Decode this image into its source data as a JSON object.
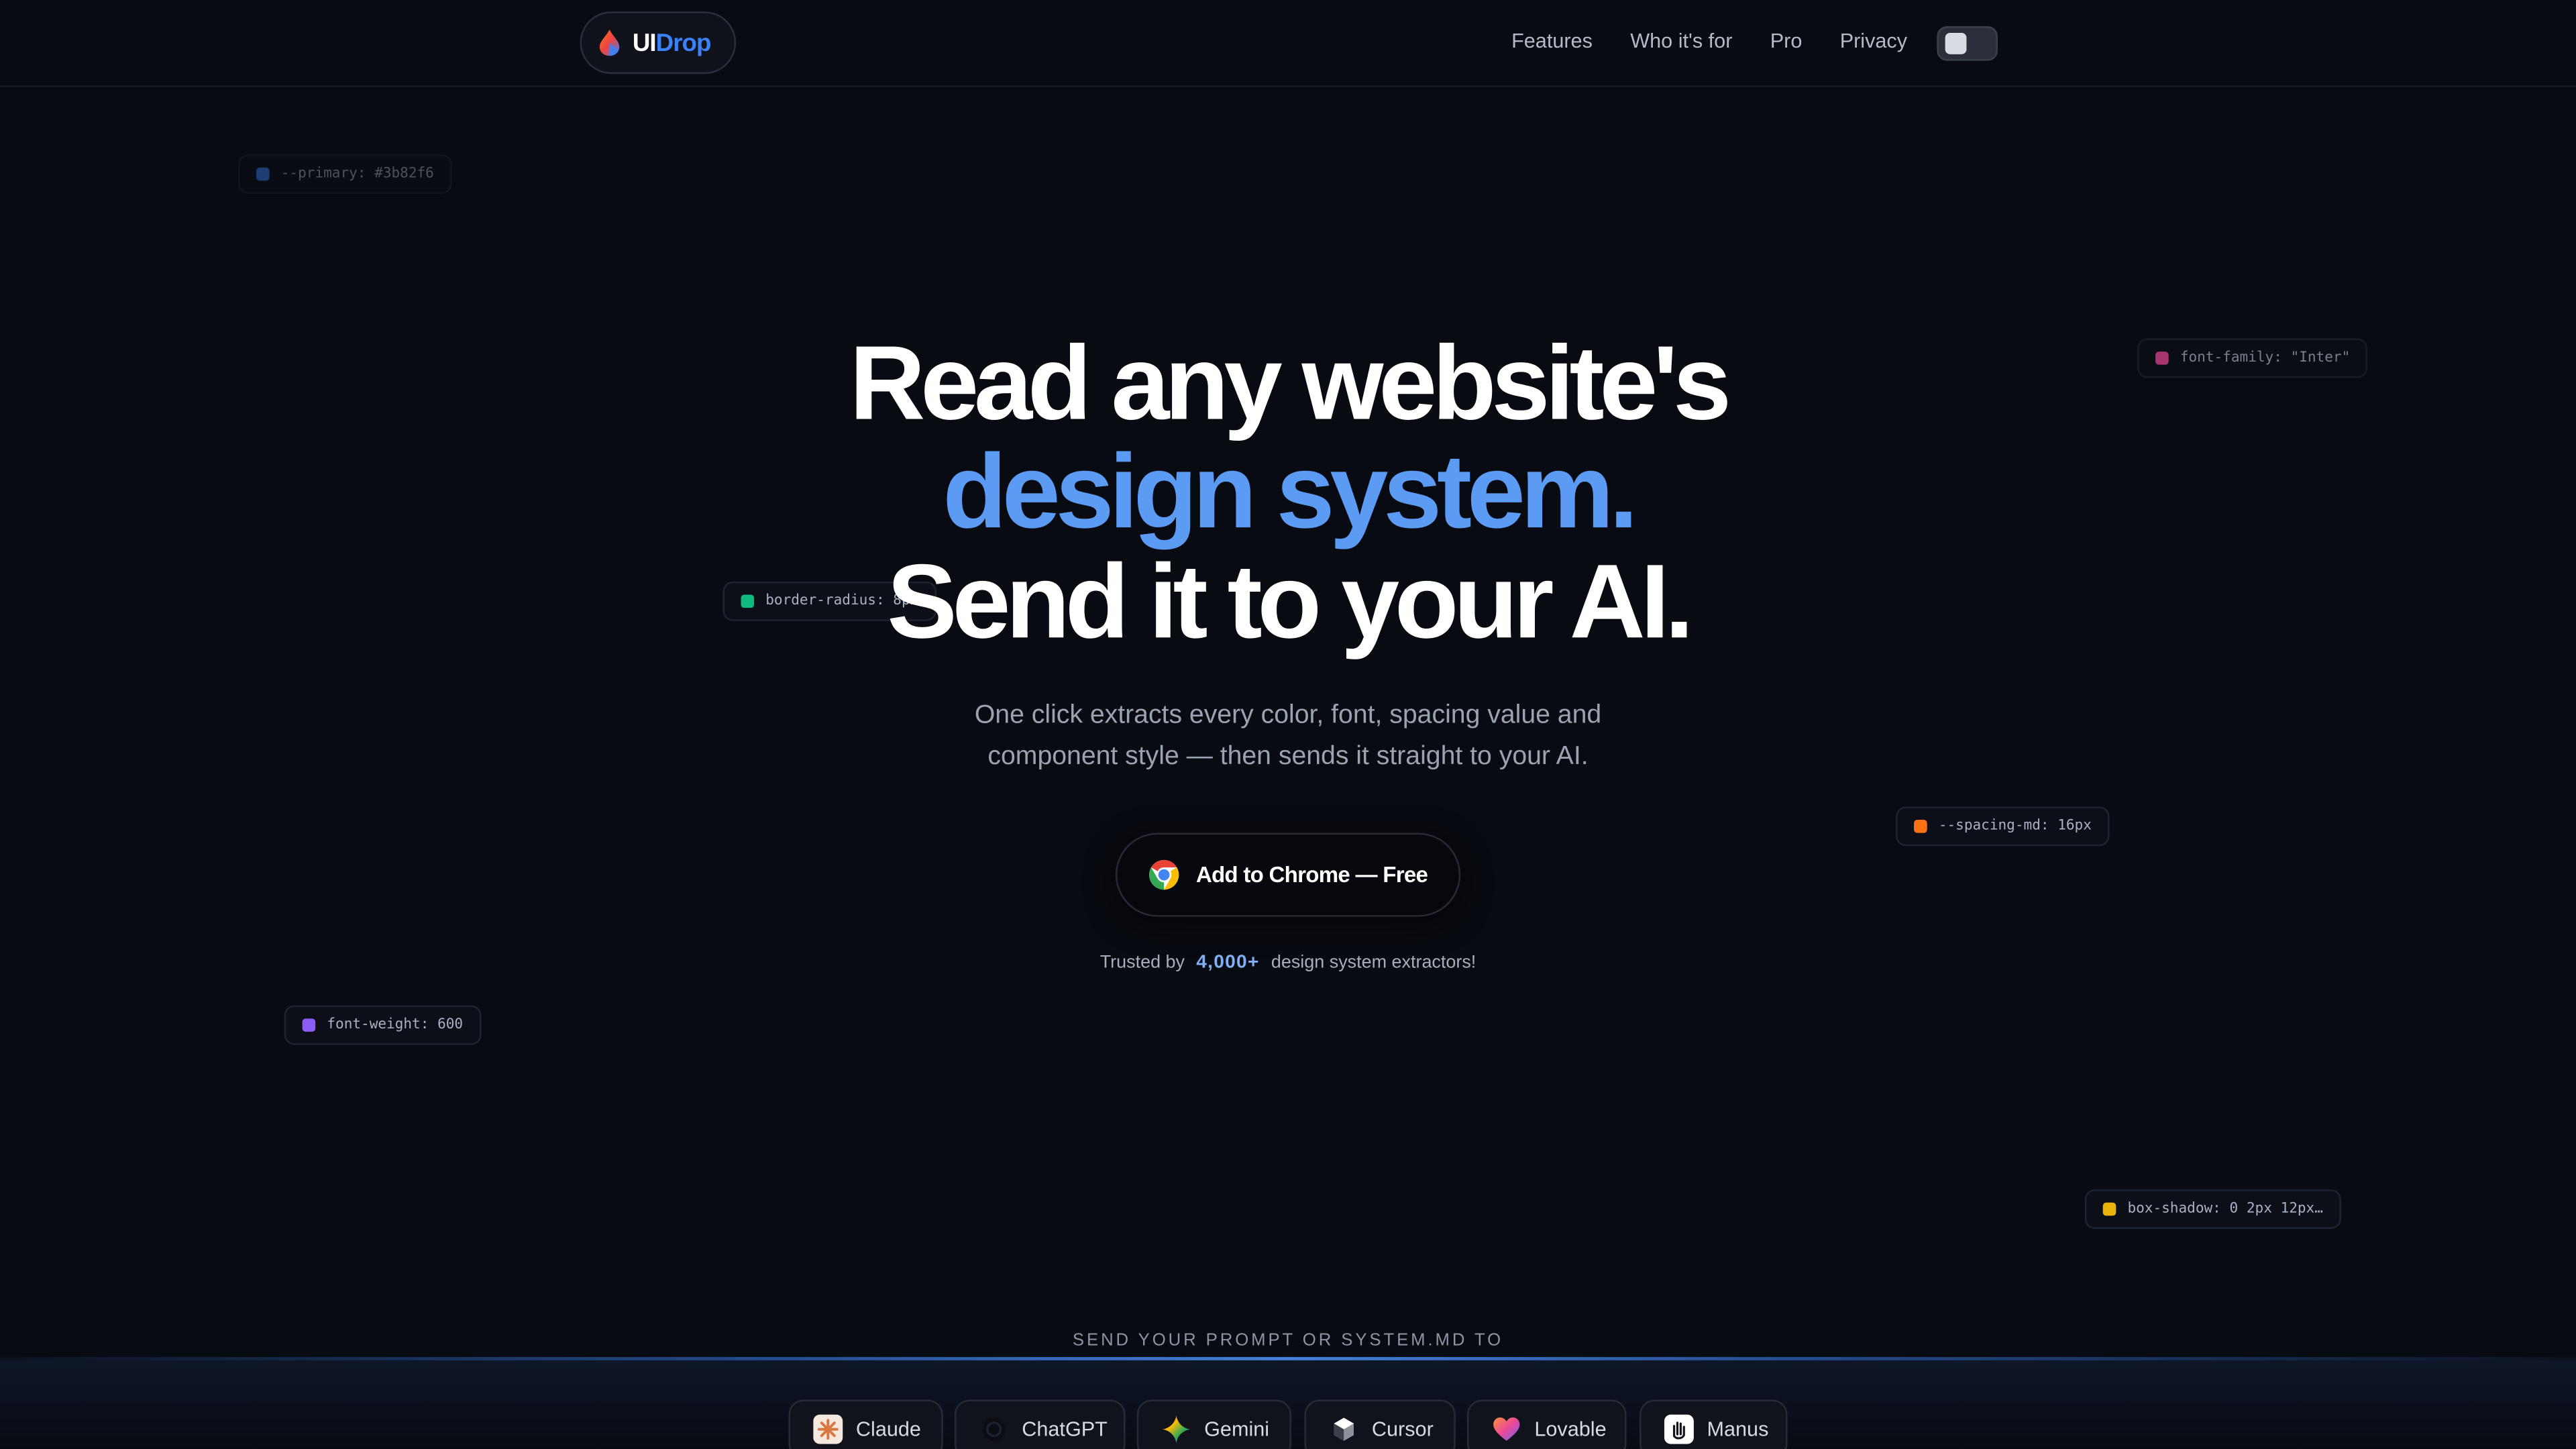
{
  "brand": {
    "prefix": "UI",
    "suffix": "Drop",
    "accent": "#3b82f6"
  },
  "nav": {
    "items": [
      "Features",
      "Who it's for",
      "Pro",
      "Privacy"
    ]
  },
  "theme_toggle": {
    "state": "off"
  },
  "tokens": {
    "primary": "--primary: #3b82f6",
    "font_family": "font-family: \"Inter\"",
    "border_radius": "border-radius: 8px",
    "spacing_md": "--spacing-md: 16px",
    "font_weight": "font-weight: 600",
    "box_shadow": "box-shadow: 0 2px 12px…"
  },
  "token_colors": {
    "primary": "#3b82f6",
    "font_family": "#ec4899",
    "border_radius": "#10b981",
    "spacing_md": "#f97316",
    "font_weight": "#8b5cf6",
    "box_shadow": "#eab308"
  },
  "hero": {
    "line1": "Read any website's",
    "line2": "design system.",
    "line3": "Send it to your AI.",
    "subtitle_line1": "One click extracts every color, font, spacing value and",
    "subtitle_line2": "component style — then sends it straight to your AI."
  },
  "cta": {
    "label": "Add to Chrome — Free",
    "icon": "chrome-icon"
  },
  "trusted": {
    "prefix": "Trusted by",
    "count": "4,000+",
    "suffix": "design system extractors!"
  },
  "ai_bar": {
    "label": "SEND YOUR PROMPT OR SYSTEM.MD TO",
    "items": [
      "Claude",
      "ChatGPT",
      "Gemini",
      "Cursor",
      "Lovable",
      "Manus"
    ]
  }
}
